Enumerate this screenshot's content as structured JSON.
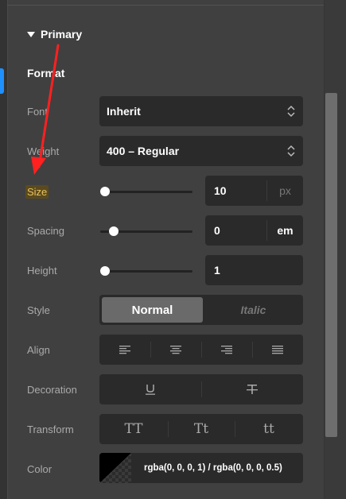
{
  "section": {
    "title": "Primary"
  },
  "format": {
    "title": "Format",
    "labels": {
      "font": "Font",
      "weight": "Weight",
      "size": "Size",
      "spacing": "Spacing",
      "height": "Height",
      "style": "Style",
      "align": "Align",
      "decoration": "Decoration",
      "transform": "Transform",
      "color": "Color"
    },
    "font_value": "Inherit",
    "weight_value": "400 – Regular",
    "size": {
      "value": "10",
      "unit": "px",
      "slider_level": 0.0
    },
    "spacing": {
      "value": "0",
      "unit": "em",
      "slider_level": 0.1
    },
    "height": {
      "value": "1",
      "slider_level": 0.0
    },
    "style_options": [
      "Normal",
      "Italic"
    ],
    "style_selected": "Normal",
    "transform_options": [
      "TT",
      "Tt",
      "tt"
    ],
    "color_value": "rgba(0, 0, 0, 1) / rgba(0, 0, 0, 0.5)"
  },
  "icons": {
    "align": [
      "align-left-icon",
      "align-center-icon",
      "align-right-icon",
      "align-justify-icon"
    ],
    "decoration": [
      "underline-icon",
      "strikethrough-icon"
    ],
    "select": "chevron-updown-icon",
    "section": "triangle-down-icon"
  },
  "colors": {
    "accent": "#1e90ff",
    "highlight": "#5a4a1e",
    "annotation_arrow": "#ff2020"
  }
}
